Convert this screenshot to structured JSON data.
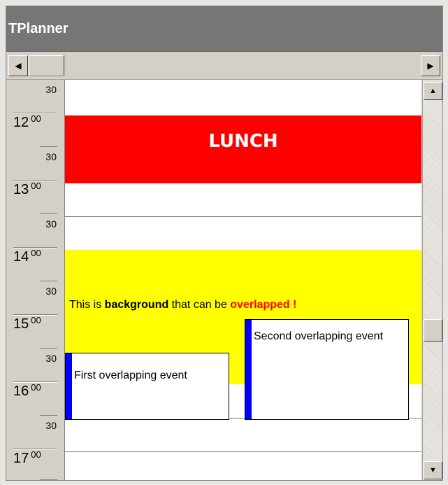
{
  "window": {
    "title": "TPlanner"
  },
  "scrollbars": {
    "left_icon": "triangle-left-icon",
    "right_icon": "triangle-right-icon",
    "up_icon": "triangle-up-icon",
    "down_icon": "triangle-down-icon"
  },
  "time_labels": {
    "h12": "12",
    "h13": "13",
    "h14": "14",
    "h15": "15",
    "h16": "16",
    "h17": "17",
    "minutes_00": "00",
    "minutes_30": "30"
  },
  "events": {
    "lunch": {
      "title": "LUNCH",
      "color": "#ff0000"
    },
    "background": {
      "text_before": "This is ",
      "text_bold": "background",
      "text_middle": " that can be ",
      "text_highlight": "overlapped !",
      "color": "#ffff00"
    },
    "first": {
      "title": "First overlapping event"
    },
    "second": {
      "title": "Second overlapping event"
    },
    "event_bar_color": "#0000ff"
  }
}
